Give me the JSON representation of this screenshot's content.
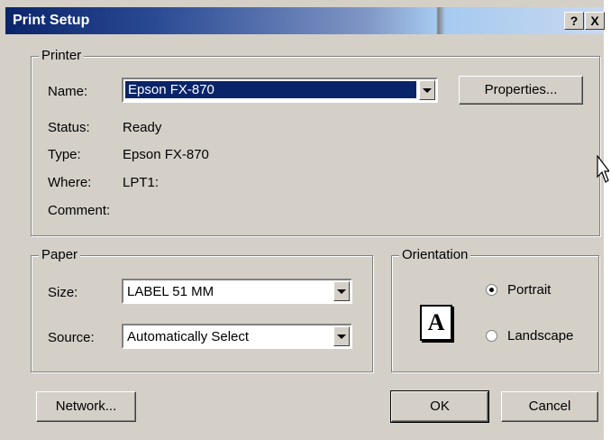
{
  "window": {
    "title": "Print Setup",
    "help_label": "?",
    "close_label": "X"
  },
  "printer": {
    "legend": "Printer",
    "name_label": "Name:",
    "name_value": "Epson FX-870",
    "properties_label": "Properties...",
    "status_label": "Status:",
    "status_value": "Ready",
    "type_label": "Type:",
    "type_value": "Epson FX-870",
    "where_label": "Where:",
    "where_value": "LPT1:",
    "comment_label": "Comment:"
  },
  "paper": {
    "legend": "Paper",
    "size_label": "Size:",
    "size_value": "LABEL 51 MM",
    "source_label": "Source:",
    "source_value": "Automatically Select"
  },
  "orientation": {
    "legend": "Orientation",
    "icon_letter": "A",
    "portrait_label": "Portrait",
    "portrait_selected": true,
    "landscape_label": "Landscape",
    "landscape_selected": false
  },
  "buttons": {
    "network_label": "Network...",
    "ok_label": "OK",
    "cancel_label": "Cancel"
  }
}
